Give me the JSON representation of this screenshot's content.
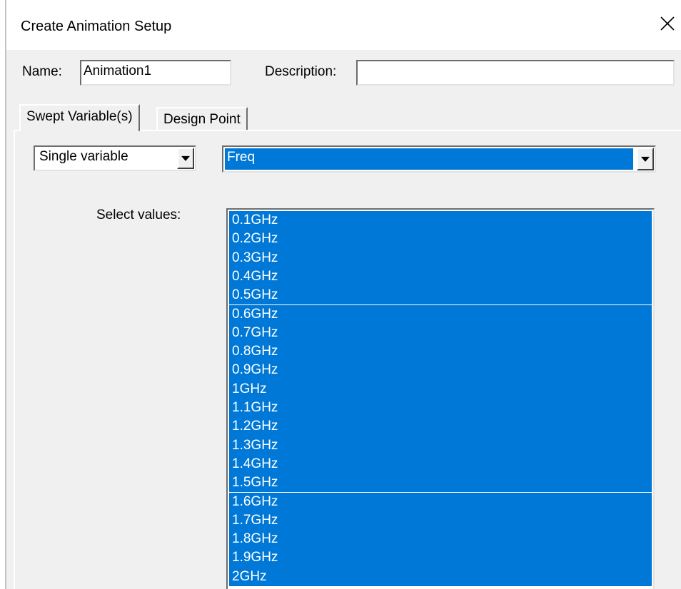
{
  "window": {
    "title": "Create Animation Setup"
  },
  "name_field": {
    "label": "Name:",
    "value": "Animation1"
  },
  "description_field": {
    "label": "Description:",
    "value": ""
  },
  "tabs": [
    {
      "label": "Swept Variable(s)",
      "active": true
    },
    {
      "label": "Design Point",
      "active": false
    }
  ],
  "mode_select": {
    "value": "Single variable"
  },
  "variable_select": {
    "value": "Freq"
  },
  "values_list": {
    "label": "Select values:",
    "items": [
      "0.1GHz",
      "0.2GHz",
      "0.3GHz",
      "0.4GHz",
      "0.5GHz",
      "0.6GHz",
      "0.7GHz",
      "0.8GHz",
      "0.9GHz",
      "1GHz",
      "1.1GHz",
      "1.2GHz",
      "1.3GHz",
      "1.4GHz",
      "1.5GHz",
      "1.6GHz",
      "1.7GHz",
      "1.8GHz",
      "1.9GHz",
      "2GHz"
    ],
    "all_selected": true
  },
  "colors": {
    "selection": "#0078d7",
    "dialog_bg": "#f0f0f0"
  }
}
